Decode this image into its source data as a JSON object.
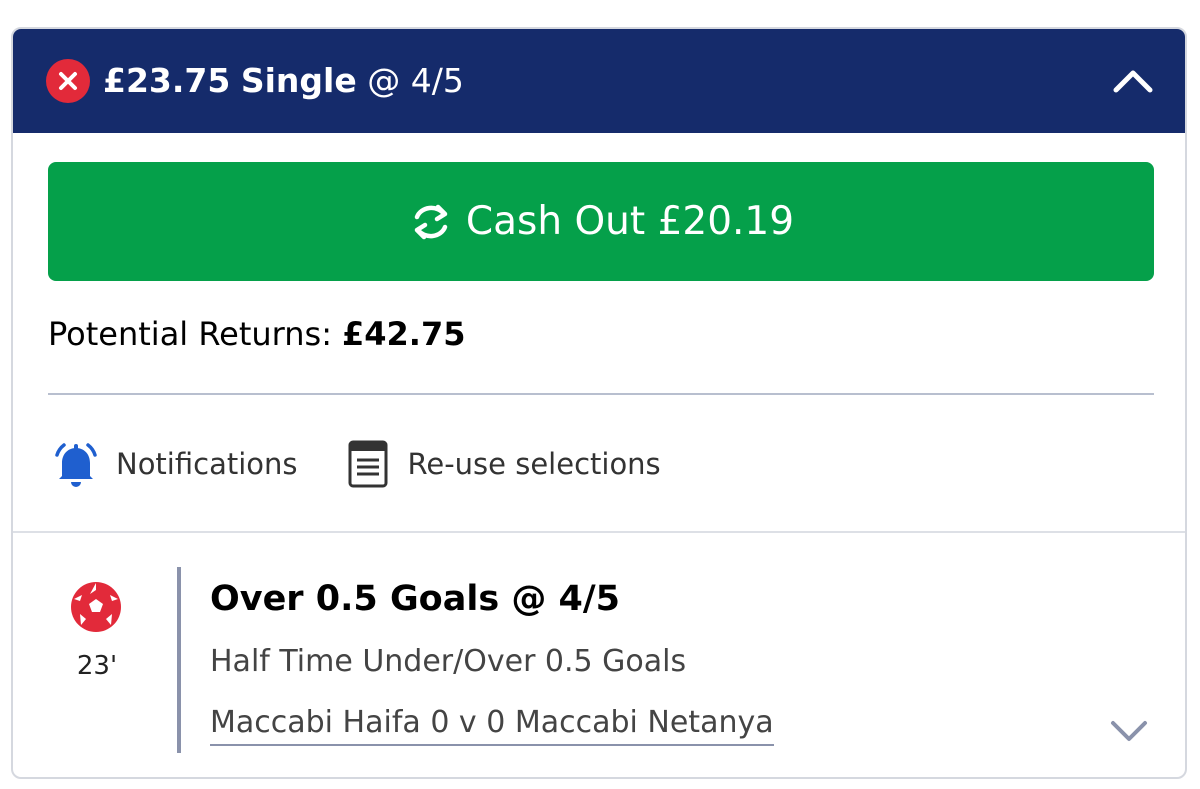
{
  "bet": {
    "stake": "£23.75",
    "bet_type": "Single",
    "odds_label": "@ 4/5",
    "status_icon": "cross-icon",
    "colors": {
      "header_bg": "#152b6b",
      "status_red": "#e22a3a",
      "cashout_green": "#05a04a"
    }
  },
  "cashout": {
    "label": "Cash Out £20.19",
    "icon": "refresh-icon"
  },
  "returns": {
    "label": "Potential Returns:",
    "value": "£42.75"
  },
  "actions": [
    {
      "label": "Notifications",
      "icon": "bell-icon"
    },
    {
      "label": "Re-use selections",
      "icon": "document-icon"
    }
  ],
  "selection": {
    "sport_icon": "football-icon",
    "time": "23'",
    "title": "Over 0.5 Goals @ 4/5",
    "market": "Half Time Under/Over 0.5 Goals",
    "event": "Maccabi Haifa 0 v 0 Maccabi Netanya"
  }
}
